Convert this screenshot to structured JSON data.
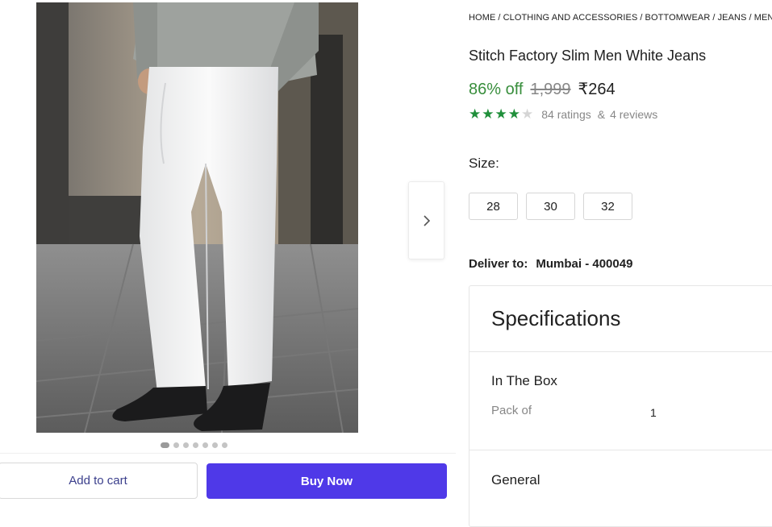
{
  "breadcrumb": [
    "HOME",
    "CLOTHING AND ACCESSORIES",
    "BOTTOMWEAR",
    "JEANS",
    "MEN"
  ],
  "breadcrumb_separator": "/",
  "product": {
    "title": "Stitch Factory Slim Men White Jeans",
    "discount": "86% off",
    "mrp": "1,999",
    "price": "₹264",
    "rating_stars": 4,
    "rating_max": 5,
    "ratings_text": "84 ratings",
    "reviews_text": "4 reviews",
    "ratings_joiner": "&"
  },
  "gallery": {
    "image_count": 7,
    "active_index": 0
  },
  "size": {
    "label": "Size:",
    "options": [
      "28",
      "30",
      "32"
    ]
  },
  "delivery": {
    "label": "Deliver to:",
    "location": "Mumbai - 400049"
  },
  "specifications": {
    "title": "Specifications",
    "sections": [
      {
        "title": "In The Box",
        "rows": [
          {
            "key": "Pack of",
            "value": "1"
          }
        ]
      },
      {
        "title": "General"
      }
    ]
  },
  "actions": {
    "add_to_cart": "Add to cart",
    "buy_now": "Buy Now"
  },
  "colors": {
    "buy_now": "#4f39e8",
    "discount": "#388e3c",
    "star": "#1f8f3a"
  },
  "icons": {
    "next": "chevron-right-icon",
    "star": "star-icon"
  }
}
